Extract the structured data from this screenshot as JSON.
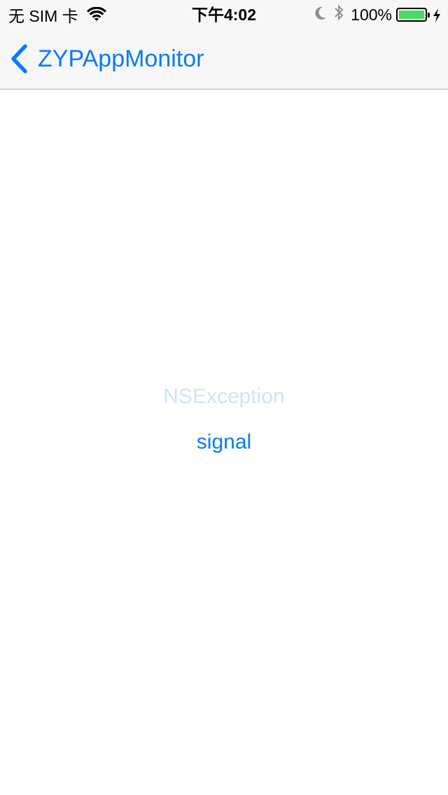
{
  "status_bar": {
    "carrier": "无 SIM 卡",
    "time": "下午4:02",
    "battery": "100%",
    "battery_level": 1.0,
    "battery_color": "#4cd964",
    "icons": [
      "wifi-icon",
      "moon-icon",
      "bluetooth-icon",
      "battery-icon",
      "charging-icon"
    ]
  },
  "nav": {
    "back_label": "ZYPAppMonitor",
    "back_icon": "chevron-left-icon",
    "tint": "#0a7bf4"
  },
  "actions": [
    {
      "label": "NSException",
      "state": "disabled"
    },
    {
      "label": "signal",
      "state": "enabled"
    }
  ]
}
